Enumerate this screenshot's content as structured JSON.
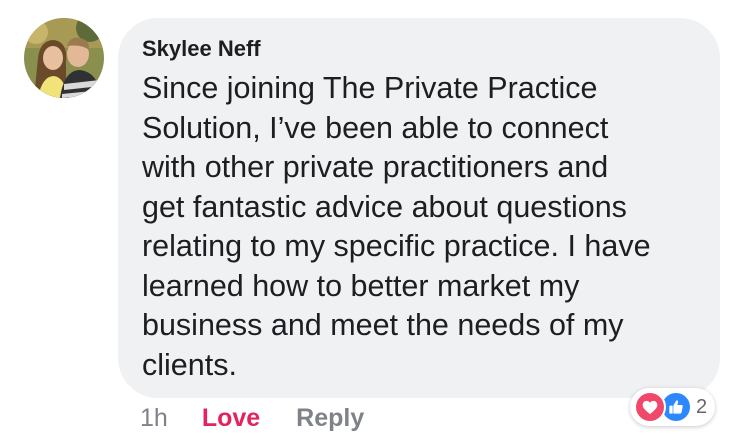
{
  "comment": {
    "author": "Skylee Neff",
    "avatar_icon": "profile-photo",
    "text": "Since joining The Private Practice\nSolution, I’ve been able to connect\nwith other private practitioners and\nget fantastic advice about questions\nrelating to my specific practice.  I have\nlearned how to better market my\nbusiness and meet the needs of my\nclients."
  },
  "actions": {
    "timestamp": "1h",
    "love_label": "Love",
    "reply_label": "Reply"
  },
  "reactions": {
    "icons": [
      "heart-icon",
      "thumbs-up-icon"
    ],
    "count": "2"
  },
  "colors": {
    "bubble_background": "#f0f1f3",
    "love_active": "#e0245e",
    "muted_text": "#7f8288",
    "like_blue": "#2d88ff",
    "love_red": "#f0476a"
  }
}
